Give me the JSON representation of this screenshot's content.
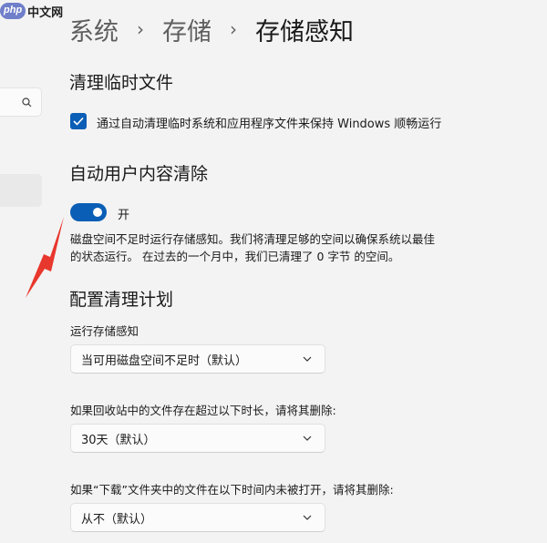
{
  "watermark": {
    "logo": "php",
    "text": "中文网"
  },
  "breadcrumb": {
    "level1": "系统",
    "level2": "存储",
    "current": "存储感知",
    "separator": "›"
  },
  "temp_files": {
    "title": "清理临时文件",
    "checkbox_label": "通过自动清理临时系统和应用程序文件来保持 Windows 顺畅运行",
    "checked": true
  },
  "auto_cleanup": {
    "title": "自动用户内容清除",
    "toggle_label": "开",
    "toggle_on": true,
    "desc_line1": "磁盘空间不足时运行存储感知。我们将清理足够的空间以确保系统以最佳",
    "desc_line2": "的状态运行。 在过去的一个月中，我们已清理了 0 字节 的空间。"
  },
  "schedule": {
    "title": "配置清理计划",
    "run_label": "运行存储感知",
    "run_value": "当可用磁盘空间不足时（默认）",
    "recycle_label": "如果回收站中的文件存在超过以下时长，请将其删除:",
    "recycle_value": "30天（默认）",
    "downloads_label": "如果“下载”文件夹中的文件在以下时间内未被打开，请将其删除:",
    "downloads_value": "从不（默认）"
  },
  "colors": {
    "accent": "#0a5eb5",
    "annotation_arrow": "#e8372d",
    "background": "#f3f3f3"
  },
  "icons": [
    "search-icon",
    "checkmark-icon",
    "chevron-down-icon",
    "annotation-arrow"
  ]
}
